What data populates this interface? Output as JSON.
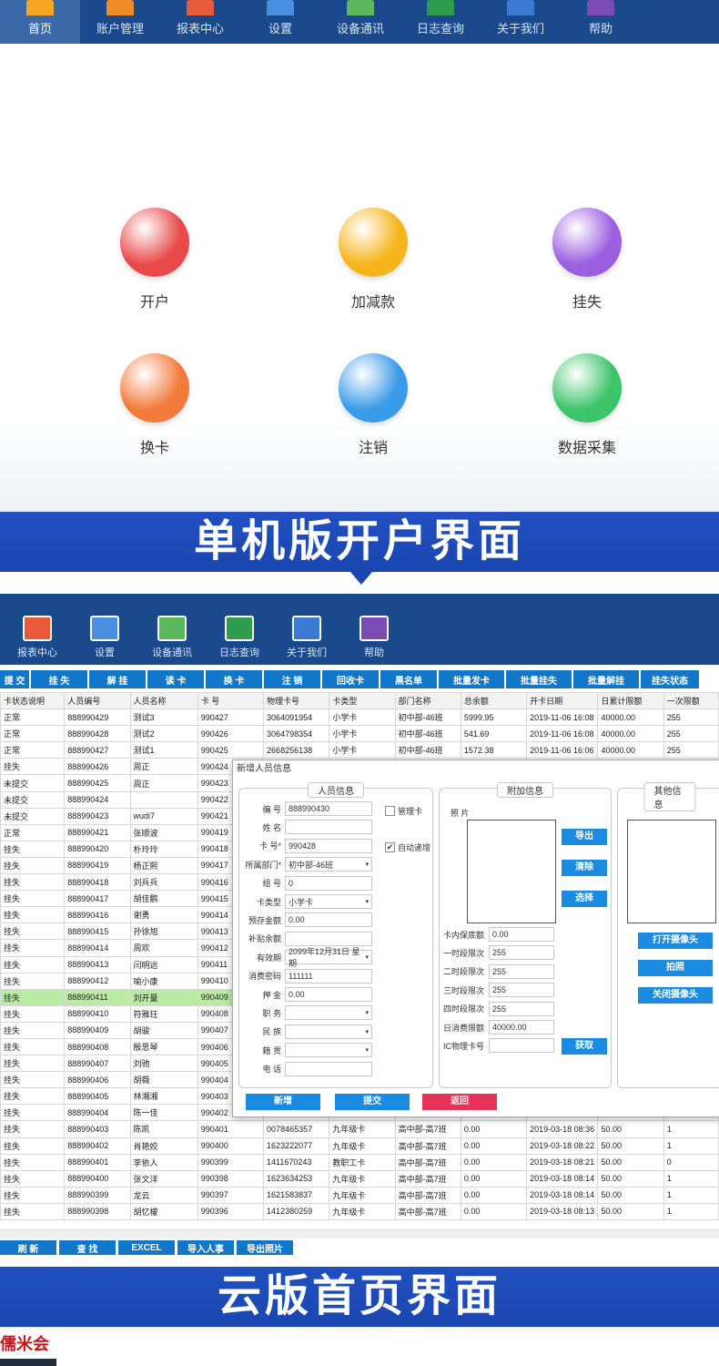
{
  "topnav": {
    "items": [
      {
        "label": "首页",
        "icon": "home-icon",
        "color": "#f5a623"
      },
      {
        "label": "账户管理",
        "icon": "account-icon",
        "color": "#f08a24"
      },
      {
        "label": "报表中心",
        "icon": "report-icon",
        "color": "#e85a3a"
      },
      {
        "label": "设置",
        "icon": "settings-icon",
        "color": "#4a90e2"
      },
      {
        "label": "设备通讯",
        "icon": "device-icon",
        "color": "#5cb85c"
      },
      {
        "label": "日志查询",
        "icon": "log-icon",
        "color": "#2e9b4f"
      },
      {
        "label": "关于我们",
        "icon": "about-icon",
        "color": "#3a7bd5"
      },
      {
        "label": "帮助",
        "icon": "help-icon",
        "color": "#7b4bb5"
      }
    ]
  },
  "home": {
    "tiles": [
      {
        "label": "开户",
        "icon": "user-icon",
        "color": "#e84a4a"
      },
      {
        "label": "加减款",
        "icon": "money-icon",
        "color": "#f5b51b"
      },
      {
        "label": "挂失",
        "icon": "lock-icon",
        "color": "#9b5fe0"
      },
      {
        "label": "换卡",
        "icon": "card-icon",
        "color": "#f27a3a"
      },
      {
        "label": "注销",
        "icon": "logout-icon",
        "color": "#3a9be8"
      },
      {
        "label": "数据采集",
        "icon": "cloud-download-icon",
        "color": "#3cc46a"
      }
    ]
  },
  "banners": {
    "standalone": "单机版开户界面",
    "cloud": "云版首页界面"
  },
  "app1": {
    "nav": [
      "报表中心",
      "设置",
      "设备通讯",
      "日志查询",
      "关于我们",
      "帮助"
    ],
    "toolbar": [
      "提 交",
      "挂 失",
      "解 挂",
      "读 卡",
      "换 卡",
      "注 销",
      "回收卡",
      "黑名单",
      "批量发卡",
      "批量挂失",
      "批量解挂",
      "挂失状态"
    ],
    "columns": [
      "卡状态说明",
      "人员编号",
      "人员名称",
      "卡 号",
      "物理卡号",
      "卡类型",
      "部门名称",
      "总余额",
      "开卡日期",
      "日累计限额",
      "一次限额"
    ],
    "rows": [
      [
        "正常",
        "888990429",
        "测试3",
        "990427",
        "3064091954",
        "小学卡",
        "初中部-46班",
        "5999.95",
        "2019-11-06 16:08",
        "40000.00",
        "255"
      ],
      [
        "正常",
        "888990428",
        "测试2",
        "990426",
        "3064798354",
        "小学卡",
        "初中部-46班",
        "541.69",
        "2019-11-06 16:08",
        "40000.00",
        "255"
      ],
      [
        "正常",
        "888990427",
        "测试1",
        "990425",
        "2668256138",
        "小学卡",
        "初中部-46班",
        "1572.38",
        "2019-11-06 16:06",
        "40000.00",
        "255"
      ],
      [
        "挂失",
        "888990426",
        "周正",
        "990424",
        "",
        "",
        "",
        "",
        "",
        "",
        ""
      ],
      [
        "未提交",
        "888990425",
        "周正",
        "990423",
        "",
        "",
        "",
        "",
        "",
        "",
        ""
      ],
      [
        "未提交",
        "888990424",
        "",
        "990422",
        "",
        "",
        "",
        "",
        "",
        "",
        ""
      ],
      [
        "未提交",
        "888990423",
        "wudi7",
        "990421",
        "",
        "",
        "",
        "",
        "",
        "",
        ""
      ],
      [
        "正常",
        "888990421",
        "张顺波",
        "990419",
        "",
        "",
        "",
        "",
        "",
        "",
        ""
      ],
      [
        "挂失",
        "888990420",
        "朴玲玲",
        "990418",
        "",
        "",
        "",
        "",
        "",
        "",
        ""
      ],
      [
        "挂失",
        "888990419",
        "杨正熙",
        "990417",
        "",
        "",
        "",
        "",
        "",
        "",
        ""
      ],
      [
        "挂失",
        "888990418",
        "刘兵兵",
        "990416",
        "",
        "",
        "",
        "",
        "",
        "",
        ""
      ],
      [
        "挂失",
        "888990417",
        "胡佳鹏",
        "990415",
        "",
        "",
        "",
        "",
        "",
        "",
        ""
      ],
      [
        "挂失",
        "888990416",
        "谢勇",
        "990414",
        "",
        "",
        "",
        "",
        "",
        "",
        ""
      ],
      [
        "挂失",
        "888990415",
        "孙徐旭",
        "990413",
        "",
        "",
        "",
        "",
        "",
        "",
        ""
      ],
      [
        "挂失",
        "888990414",
        "周欢",
        "990412",
        "",
        "",
        "",
        "",
        "",
        "",
        ""
      ],
      [
        "挂失",
        "888990413",
        "闫明远",
        "990411",
        "",
        "",
        "",
        "",
        "",
        "",
        ""
      ],
      [
        "挂失",
        "888990412",
        "喻小康",
        "990410",
        "",
        "",
        "",
        "",
        "",
        "",
        ""
      ],
      [
        "挂失",
        "888990411",
        "刘开量",
        "990409",
        "",
        "",
        "",
        "",
        "",
        "",
        ""
      ],
      [
        "挂失",
        "888990410",
        "符雅玨",
        "990408",
        "",
        "",
        "",
        "",
        "",
        "",
        ""
      ],
      [
        "挂失",
        "888990409",
        "胡骏",
        "990407",
        "",
        "",
        "",
        "",
        "",
        "",
        ""
      ],
      [
        "挂失",
        "888990408",
        "殷思琴",
        "990406",
        "",
        "",
        "",
        "",
        "",
        "",
        ""
      ],
      [
        "挂失",
        "888990407",
        "刘驰",
        "990405",
        "",
        "",
        "",
        "",
        "",
        "",
        ""
      ],
      [
        "挂失",
        "888990406",
        "胡薇",
        "990404",
        "",
        "",
        "",
        "",
        "",
        "",
        ""
      ],
      [
        "挂失",
        "888990405",
        "林湘湘",
        "990403",
        "",
        "",
        "",
        "",
        "",
        "",
        ""
      ],
      [
        "挂失",
        "888990404",
        "陈一佳",
        "990402",
        "",
        "",
        "",
        "",
        "",
        "",
        ""
      ],
      [
        "挂失",
        "888990403",
        "陈凯",
        "990401",
        "0078465357",
        "九年级卡",
        "高中部-高7班",
        "0.00",
        "2019-03-18 08:36",
        "50.00",
        "1"
      ],
      [
        "挂失",
        "888990402",
        "肖艳姣",
        "990400",
        "1623222077",
        "九年级卡",
        "高中部-高7班",
        "0.00",
        "2019-03-18 08:22",
        "50.00",
        "1"
      ],
      [
        "挂失",
        "888990401",
        "李依人",
        "990399",
        "1411670243",
        "教职工卡",
        "高中部-高7班",
        "0.00",
        "2019-03-18 08:21",
        "50.00",
        "0"
      ],
      [
        "挂失",
        "888990400",
        "张文洋",
        "990398",
        "1623634253",
        "九年级卡",
        "高中部-高7班",
        "0.00",
        "2019-03-18 08:14",
        "50.00",
        "1"
      ],
      [
        "挂失",
        "888990399",
        "龙云",
        "990397",
        "1621583837",
        "九年级卡",
        "高中部-高7班",
        "0.00",
        "2019-03-18 08:14",
        "50.00",
        "1"
      ],
      [
        "挂失",
        "888990398",
        "胡忆檬",
        "990396",
        "1412380259",
        "九年级卡",
        "高中部-高7班",
        "0.00",
        "2019-03-18 08:13",
        "50.00",
        "1"
      ]
    ],
    "highlight_row": 17,
    "dialog": {
      "title": "新增人员信息",
      "groups": {
        "person": "人员信息",
        "extra": "附加信息",
        "other": "其他信息"
      },
      "fields": [
        {
          "label": "编  号",
          "value": "888990430"
        },
        {
          "label": "姓  名",
          "value": ""
        },
        {
          "label": "卡  号*",
          "value": "990428"
        },
        {
          "label": "所属部门*",
          "value": "初中部-46班"
        },
        {
          "label": "组  号",
          "value": "0"
        },
        {
          "label": "卡类型",
          "value": "小学卡"
        },
        {
          "label": "预存金额",
          "value": "0.00"
        },
        {
          "label": "补贴余额",
          "value": ""
        },
        {
          "label": "有效期",
          "value": "2099年12月31日 星期"
        },
        {
          "label": "消费密码",
          "value": "111111"
        },
        {
          "label": "押  金",
          "value": "0.00"
        },
        {
          "label": "职  务",
          "value": ""
        },
        {
          "label": "民  族",
          "value": ""
        },
        {
          "label": "籍  贯",
          "value": ""
        },
        {
          "label": "电  话",
          "value": ""
        }
      ],
      "admin_card": "管理卡",
      "auto_increment": "自动递增",
      "photo_label": "照    片",
      "photo_buttons": [
        "导出",
        "清除",
        "选择"
      ],
      "extra_fields": [
        {
          "label": "卡内保底额",
          "value": "0.00"
        },
        {
          "label": "一时段限次",
          "value": "255"
        },
        {
          "label": "二时段限次",
          "value": "255"
        },
        {
          "label": "三时段限次",
          "value": "255"
        },
        {
          "label": "四时段限次",
          "value": "255"
        },
        {
          "label": "日消费限额",
          "value": "40000.00"
        },
        {
          "label": "IC物理卡号",
          "value": ""
        }
      ],
      "get_button": "获取",
      "camera_buttons": [
        "打开摄像头",
        "拍照",
        "关闭摄像头"
      ],
      "actions": [
        "新增",
        "提交",
        "返回"
      ]
    },
    "bottom_buttons": [
      "刷 新",
      "查 找",
      "EXCEL",
      "导入人事",
      "导出照片"
    ]
  },
  "cloud": {
    "logo": "儒米会"
  }
}
